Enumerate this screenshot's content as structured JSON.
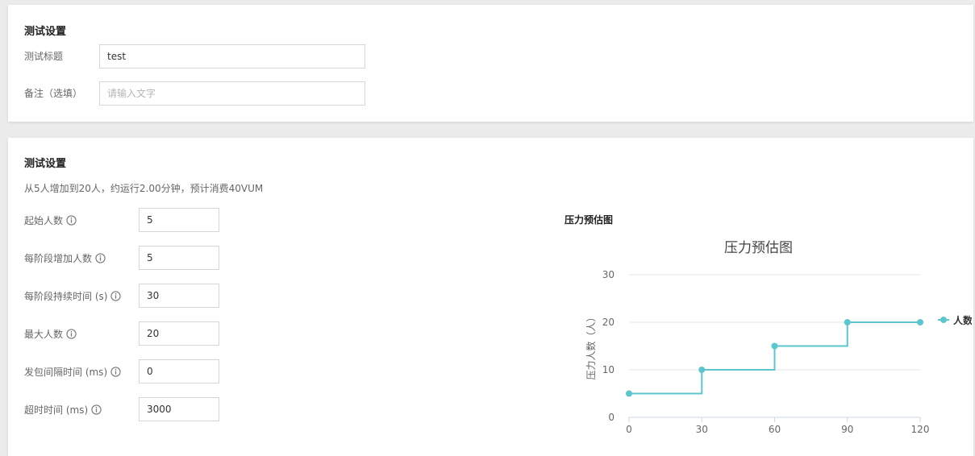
{
  "basic": {
    "title": "测试设置",
    "title_label": "测试标题",
    "title_value": "test",
    "note_label": "备注（选填）",
    "note_placeholder": "请输入文字"
  },
  "load": {
    "title": "测试设置",
    "summary": "从5人增加到20人，约运行2.00分钟，预计消费40VUM",
    "fields": [
      {
        "label": "起始人数",
        "value": "5"
      },
      {
        "label": "每阶段增加人数",
        "value": "5"
      },
      {
        "label": "每阶段持续时间 (s)",
        "value": "30"
      },
      {
        "label": "最大人数",
        "value": "20"
      },
      {
        "label": "发包间隔时间 (ms)",
        "value": "0"
      },
      {
        "label": "超时时间 (ms)",
        "value": "3000"
      }
    ],
    "info_icon": "info-icon"
  },
  "chart_section_title": "压力预估图",
  "colors": {
    "series": "#5bc6cd",
    "grid": "#e6e6e6",
    "axis_text": "#666666"
  },
  "chart_data": {
    "type": "line",
    "step": true,
    "title": "压力预估图",
    "ylabel": "压力人数（人）",
    "xlabel": "",
    "x": [
      0,
      30,
      60,
      90,
      120
    ],
    "x_ticks": [
      "0",
      "30",
      "60",
      "90",
      "120"
    ],
    "y_ticks": [
      "0",
      "10",
      "20",
      "30"
    ],
    "ylim": [
      0,
      30
    ],
    "xlim": [
      0,
      120
    ],
    "grid": true,
    "legend_position": "right",
    "series": [
      {
        "name": "人数",
        "values": [
          5,
          10,
          15,
          20,
          20
        ]
      }
    ]
  }
}
